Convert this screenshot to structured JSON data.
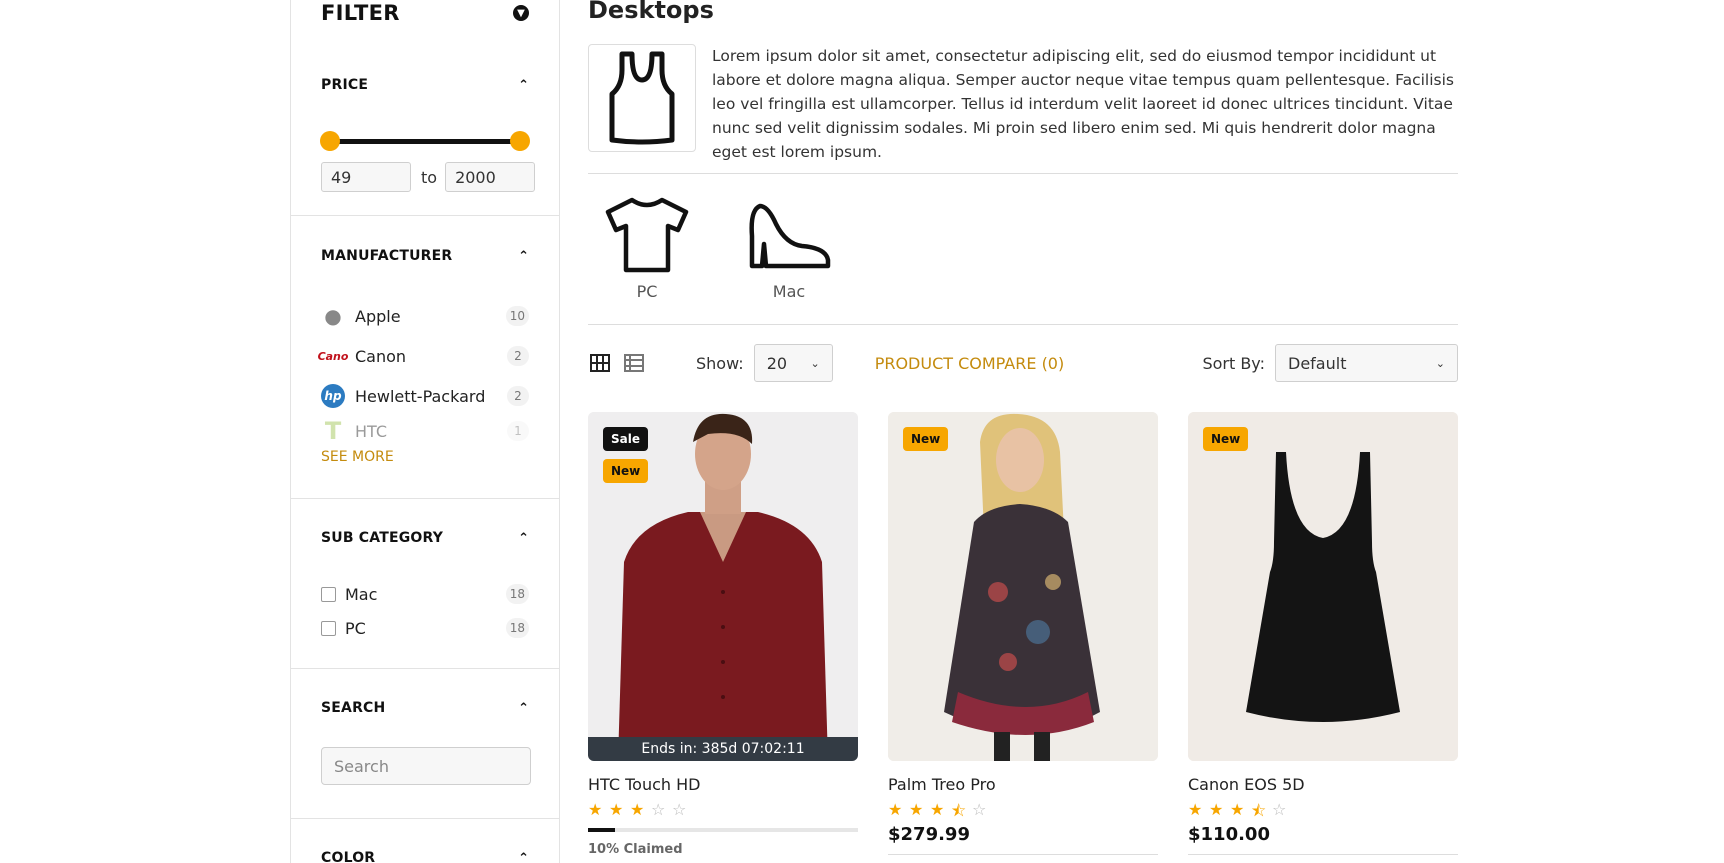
{
  "filter": {
    "title": "FILTER"
  },
  "price": {
    "title": "PRICE",
    "min": "49",
    "max": "2000",
    "to_label": "to"
  },
  "manufacturer": {
    "title": "MANUFACTURER",
    "items": [
      {
        "name": "Apple",
        "count": "10",
        "logo_icon": "apple-logo"
      },
      {
        "name": "Canon",
        "count": "2",
        "logo_icon": "canon-logo"
      },
      {
        "name": "Hewlett-Packard",
        "count": "2",
        "logo_icon": "hp-logo"
      },
      {
        "name": "HTC",
        "count": "1",
        "logo_icon": "htc-logo"
      }
    ],
    "see_more": "SEE MORE"
  },
  "subcategory": {
    "title": "SUB CATEGORY",
    "items": [
      {
        "name": "Mac",
        "count": "18"
      },
      {
        "name": "PC",
        "count": "18"
      }
    ]
  },
  "search": {
    "title": "SEARCH",
    "placeholder": "Search"
  },
  "color": {
    "title": "COLOR"
  },
  "page": {
    "title": "Desktops",
    "description": "Lorem ipsum dolor sit amet, consectetur adipiscing elit, sed do eiusmod tempor incididunt ut labore et dolore magna aliqua. Semper auctor neque vitae tempus quam pellentesque. Facilisis leo vel fringilla est ullamcorper. Tellus id interdum velit laoreet id donec ultrices tincidunt. Vitae nunc sed velit dignissim sodales. Mi proin sed libero enim sed. Mi quis hendrerit dolor magna eget est lorem ipsum.",
    "subcategories": [
      {
        "label": "PC",
        "icon": "tshirt-icon"
      },
      {
        "label": "Mac",
        "icon": "high-heel-icon"
      }
    ]
  },
  "toolbar": {
    "show_label": "Show:",
    "show_value": "20",
    "compare": "PRODUCT COMPARE (0)",
    "sort_label": "Sort By:",
    "sort_value": "Default"
  },
  "products": [
    {
      "name": "HTC Touch HD",
      "badges": [
        "Sale",
        "New"
      ],
      "rating": 3,
      "ends_in": "Ends in: 385d 07:02:11",
      "claimed_pct": 10,
      "claimed_text": "10% Claimed"
    },
    {
      "name": "Palm Treo Pro",
      "badges": [
        "New"
      ],
      "rating": 3.5,
      "price": "$279.99"
    },
    {
      "name": "Canon EOS 5D",
      "badges": [
        "New"
      ],
      "rating": 3.5,
      "price": "$110.00"
    }
  ],
  "colors": {
    "accent": "#f7a600",
    "link": "#c48b0e",
    "dark": "#111111"
  }
}
